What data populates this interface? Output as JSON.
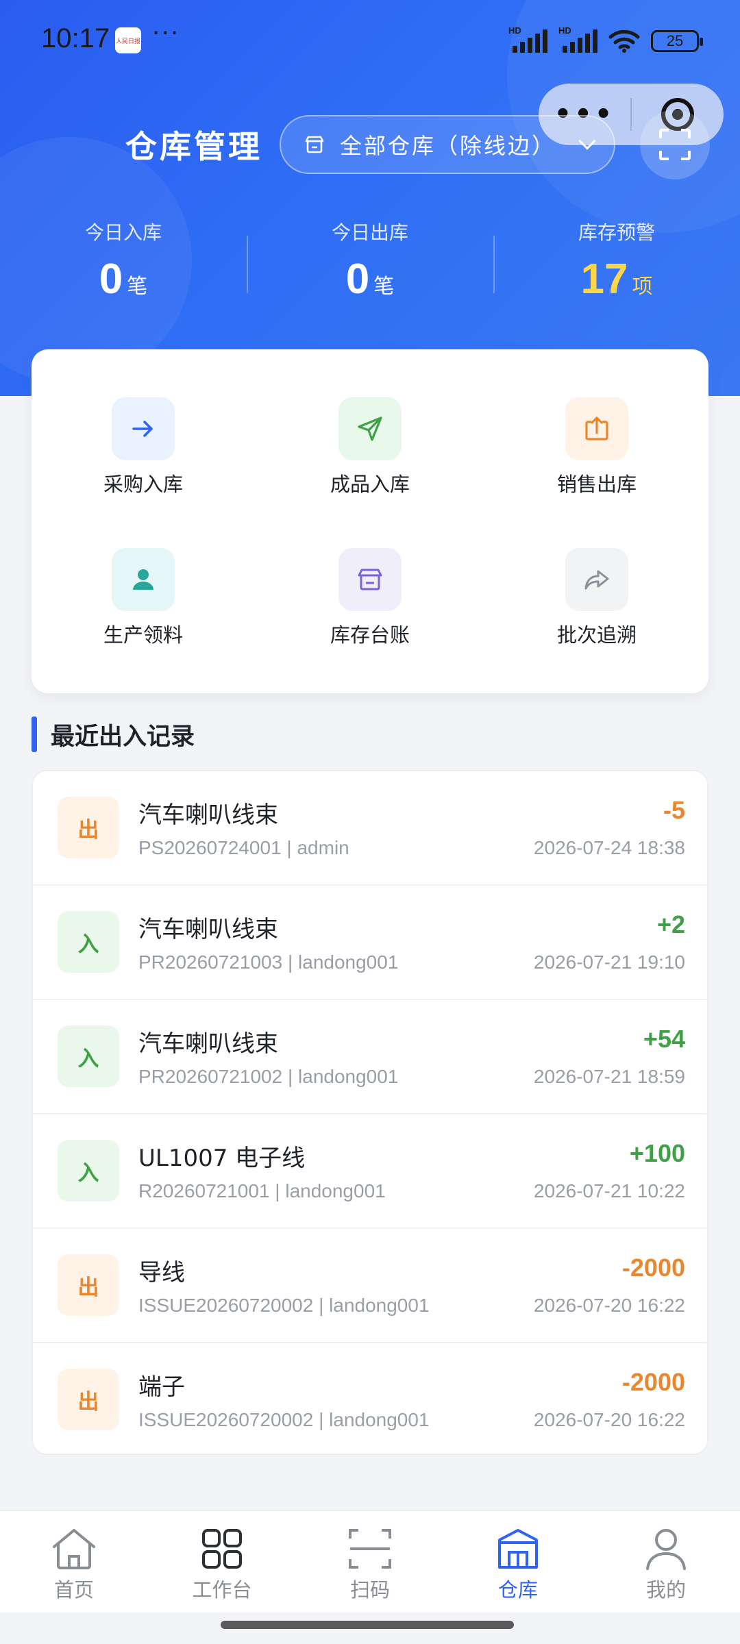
{
  "status_bar": {
    "time": "10:17",
    "app_icon_text": "人民日报",
    "dots": "···",
    "hd1": "HD",
    "hd2": "HD",
    "battery": "25"
  },
  "capsule": {
    "more_icon": "more-dots-icon",
    "target_icon": "target-icon"
  },
  "header": {
    "title": "仓库管理",
    "warehouse_select": "全部仓库（除线边）"
  },
  "stats": [
    {
      "label": "今日入库",
      "value": "0",
      "unit": "笔"
    },
    {
      "label": "今日出库",
      "value": "0",
      "unit": "笔"
    },
    {
      "label": "库存预警",
      "value": "17",
      "unit": "项"
    }
  ],
  "quick_actions": [
    {
      "label": "采购入库",
      "icon": "arrow-right-icon",
      "bg": "#eaf1ff",
      "color": "#2f63f2"
    },
    {
      "label": "成品入库",
      "icon": "send-icon",
      "bg": "#e8f8ea",
      "color": "#3fa046"
    },
    {
      "label": "销售出库",
      "icon": "upload-box-icon",
      "bg": "#fff2e6",
      "color": "#e8872e"
    },
    {
      "label": "生产领料",
      "icon": "user-icon",
      "bg": "#e4f7f6",
      "color": "#27a69a"
    },
    {
      "label": "库存台账",
      "icon": "store-icon",
      "bg": "#f1eefc",
      "color": "#7b61d6"
    },
    {
      "label": "批次追溯",
      "icon": "share-arrow-icon",
      "bg": "#f2f3f5",
      "color": "#8a8f98"
    }
  ],
  "recent": {
    "title": "最近出入记录",
    "records": [
      {
        "type": "出",
        "kind": "out",
        "name": "汽车喇叭线束",
        "meta": "PS20260724001 | admin",
        "qty": "-5",
        "time": "2026-07-24 18:38"
      },
      {
        "type": "入",
        "kind": "in",
        "name": "汽车喇叭线束",
        "meta": "PR20260721003 | landong001",
        "qty": "+2",
        "time": "2026-07-21 19:10"
      },
      {
        "type": "入",
        "kind": "in",
        "name": "汽车喇叭线束",
        "meta": "PR20260721002 | landong001",
        "qty": "+54",
        "time": "2026-07-21 18:59"
      },
      {
        "type": "入",
        "kind": "in",
        "name": "UL1007 电子线",
        "meta": "R20260721001 | landong001",
        "qty": "+100",
        "time": "2026-07-21 10:22"
      },
      {
        "type": "出",
        "kind": "out",
        "name": "导线",
        "meta": "ISSUE20260720002 | landong001",
        "qty": "-2000",
        "time": "2026-07-20 16:22"
      },
      {
        "type": "出",
        "kind": "out",
        "name": "端子",
        "meta": "ISSUE20260720002 | landong001",
        "qty": "-2000",
        "time": "2026-07-20 16:22"
      }
    ]
  },
  "tabbar": {
    "active": 3,
    "tabs": [
      {
        "label": "首页",
        "icon": "home-icon"
      },
      {
        "label": "工作台",
        "icon": "grid-icon"
      },
      {
        "label": "扫码",
        "icon": "scan-icon"
      },
      {
        "label": "仓库",
        "icon": "warehouse-icon"
      },
      {
        "label": "我的",
        "icon": "profile-icon"
      }
    ]
  },
  "colors": {
    "brand": "#2f63f2",
    "in": "#3fa046",
    "out": "#e8872e",
    "warning": "#ffd54a"
  }
}
